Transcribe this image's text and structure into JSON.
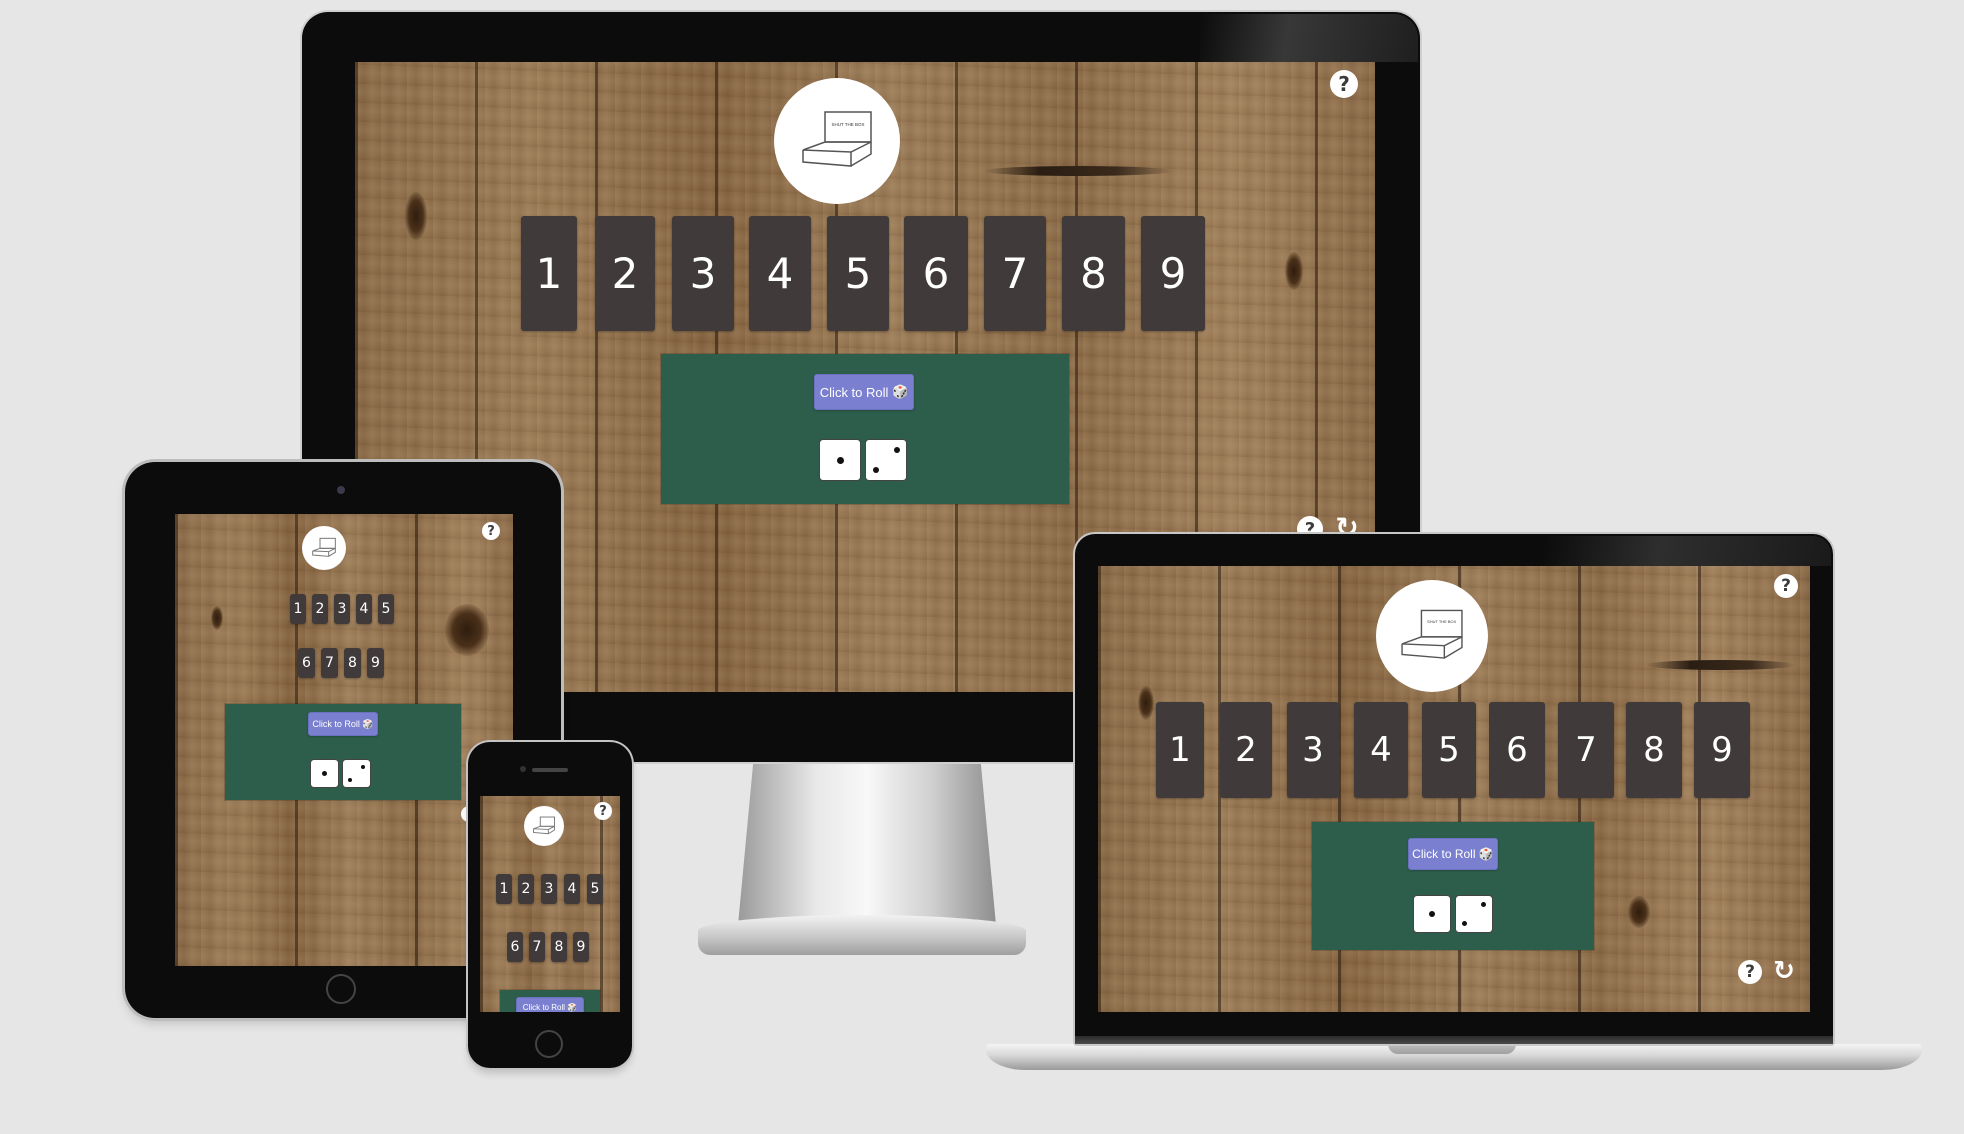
{
  "game": {
    "title": "Shut the Box",
    "logo_text": "SHUT THE BOX",
    "tiles": [
      "1",
      "2",
      "3",
      "4",
      "5",
      "6",
      "7",
      "8",
      "9"
    ],
    "tiles_row1": [
      "1",
      "2",
      "3",
      "4",
      "5"
    ],
    "tiles_row2": [
      "6",
      "7",
      "8",
      "9"
    ],
    "roll_button_label": "Click to Roll",
    "roll_button_icon": "dice-icon",
    "dice": [
      1,
      2
    ],
    "help_icon": "?",
    "refresh_icon": "↻"
  },
  "devices": [
    "desktop-monitor",
    "tablet",
    "phone",
    "laptop"
  ],
  "colors": {
    "background": "#e6e6e6",
    "tile": "#403b3a",
    "panel": "#2d5e4c",
    "button": "#7a7fcf"
  }
}
